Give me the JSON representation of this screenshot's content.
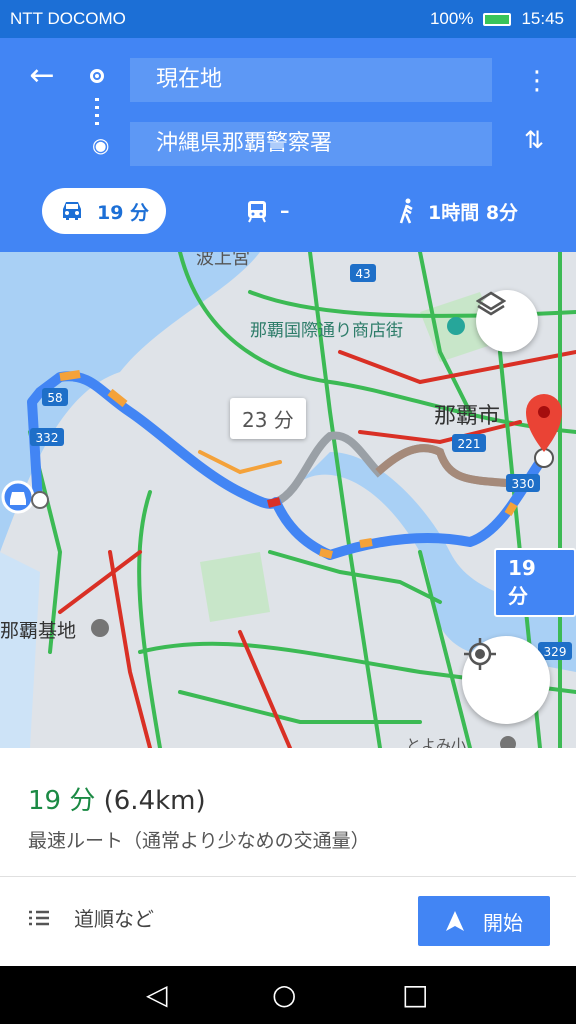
{
  "status_bar": {
    "carrier": "NTT DOCOMO",
    "battery": "100%",
    "time": "15:45"
  },
  "header": {
    "origin": "現在地",
    "destination": "沖縄県那覇警察署",
    "modes": [
      {
        "name": "car",
        "label": "19 分",
        "selected": true
      },
      {
        "name": "transit",
        "label": "–"
      },
      {
        "name": "walk",
        "label": "1時間 8分"
      }
    ]
  },
  "map": {
    "labels": {
      "district": "波上宮",
      "street": "那覇国際通り商店街",
      "city": "那覇市",
      "base": "那覇基地",
      "bottom": "とよみ小"
    },
    "route_badges": {
      "alt": "23 分",
      "main": "19 分"
    },
    "road_numbers": [
      "43",
      "58",
      "332",
      "221",
      "330",
      "329"
    ]
  },
  "summary": {
    "duration": "19 分",
    "distance": "(6.4km)",
    "description": "最速ルート（通常より少なめの交通量）",
    "steps_label": "道順など",
    "start_label": "開始"
  },
  "colors": {
    "header_blue": "#4285f4",
    "route_blue": "#4285f4",
    "alt_route": "#9aa0a6",
    "traffic_green": "#3cba54",
    "traffic_red": "#d93025",
    "traffic_orange": "#f4a23a"
  }
}
